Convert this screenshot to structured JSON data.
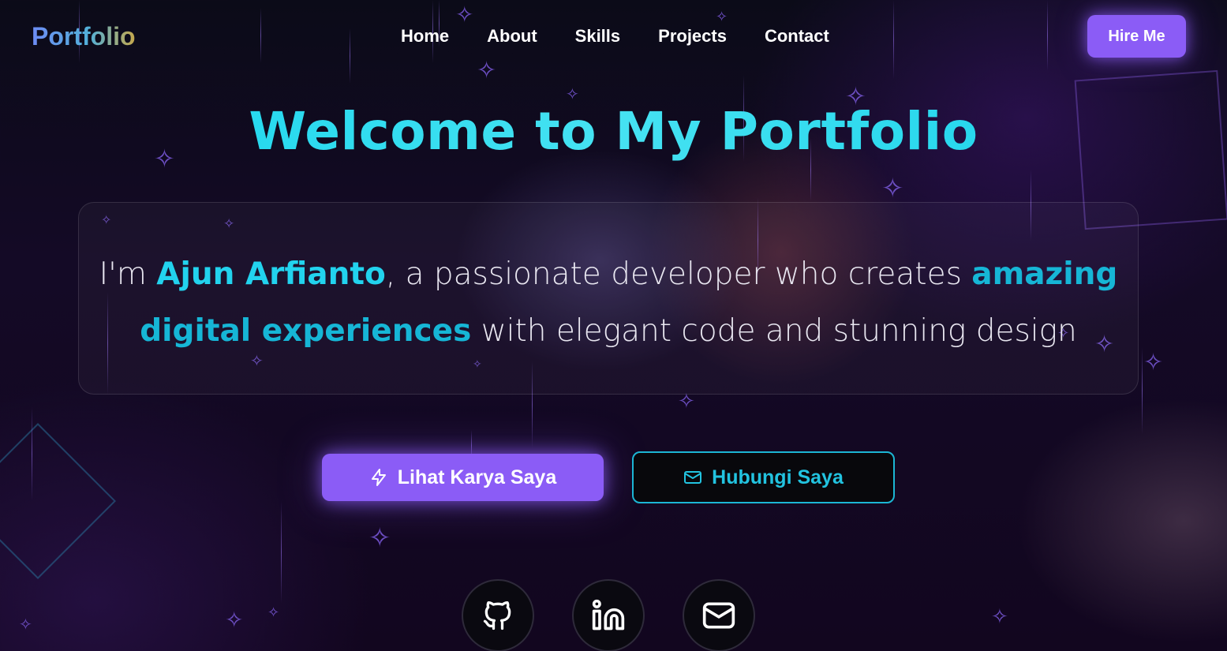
{
  "header": {
    "logo": "Portfolio",
    "nav": [
      "Home",
      "About",
      "Skills",
      "Projects",
      "Contact"
    ],
    "hire_label": "Hire Me"
  },
  "hero": {
    "title": "Welcome to My Portfolio",
    "intro": {
      "prefix": "I'm ",
      "name": "Ajun Arfianto",
      "middle": ", a passionate developer who creates ",
      "accent": "amazing digital experiences",
      "suffix": " with elegant code and stunning design"
    }
  },
  "cta": {
    "primary_label": "Lihat Karya Saya",
    "primary_icon": "lightning-icon",
    "secondary_label": "Hubungi Saya",
    "secondary_icon": "mail-icon"
  },
  "social": [
    {
      "name": "github",
      "icon": "github-icon"
    },
    {
      "name": "linkedin",
      "icon": "linkedin-icon"
    },
    {
      "name": "email",
      "icon": "mail-icon"
    }
  ],
  "colors": {
    "accent_purple": "#8b5cf6",
    "accent_cyan": "#22d3ee",
    "background": "#12061f"
  }
}
